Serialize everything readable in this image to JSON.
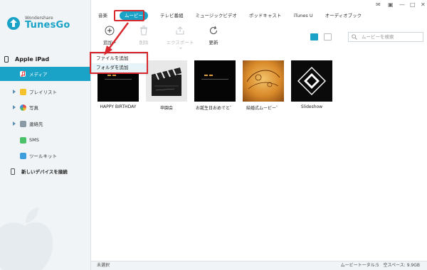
{
  "app": {
    "brand_small": "Wondershare",
    "brand_name": "TunesGo"
  },
  "window_controls": [
    "message-icon",
    "feedback-icon",
    "minimize-icon",
    "maximize-icon",
    "close-icon"
  ],
  "sidebar": {
    "device": "Apple iPad",
    "items": [
      {
        "label": "メディア",
        "icon": "music-note-icon",
        "active": true
      },
      {
        "label": "プレイリスト",
        "icon": "playlist-icon",
        "active": false
      },
      {
        "label": "写真",
        "icon": "photos-icon",
        "active": false
      },
      {
        "label": "連絡先",
        "icon": "contacts-icon",
        "active": false
      },
      {
        "label": "SMS",
        "icon": "sms-icon",
        "active": false
      },
      {
        "label": "ツールキット",
        "icon": "toolkit-icon",
        "active": false
      }
    ],
    "new_device": "新しいデバイスを接続"
  },
  "tabs": [
    "音楽",
    "ムービー",
    "テレビ番組",
    "ミュージックビデオ",
    "ポッドキャスト",
    "iTunes U",
    "オーディオブック"
  ],
  "active_tab": "ムービー",
  "toolbar": {
    "add": "追加",
    "delete": "削除",
    "export": "エクスポート",
    "refresh": "更新"
  },
  "search": {
    "placeholder": "ムービーを検索"
  },
  "add_menu": {
    "items": [
      "ファイルを追加",
      "フォルダを追加"
    ]
  },
  "movies": [
    {
      "title": "HAPPY BIRTHDAY"
    },
    {
      "title": "卒園会"
    },
    {
      "title": "お誕生日おめでと゛"
    },
    {
      "title": "結婚式ムービー゛"
    },
    {
      "title": "Slideshow"
    }
  ],
  "status": {
    "left": "未選択",
    "right": "ムービートータル:5　空スペース: 9.9GB"
  },
  "colors": {
    "accent": "#1aa3c7",
    "highlight": "#d9272e",
    "sidebar_bg": "#f1f4f6"
  }
}
